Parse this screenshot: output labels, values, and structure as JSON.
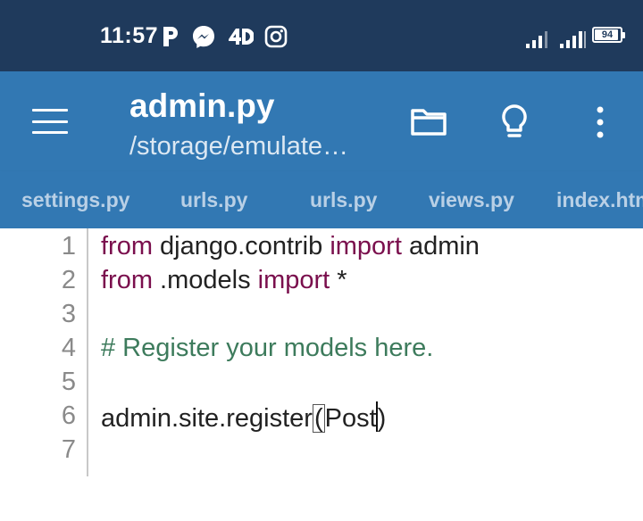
{
  "status_bar": {
    "time": "11:57",
    "notification_icons": [
      "parking-p-icon",
      "messenger-icon",
      "4d-app-icon",
      "instagram-icon"
    ],
    "battery_level": "94",
    "battery_fraction": 0.94,
    "background_color": "#1f3a5c"
  },
  "app_bar": {
    "title": "admin.py",
    "path": "/storage/emulate…",
    "menu_icon": "hamburger-menu-icon",
    "actions": [
      "folder-icon",
      "lightbulb-icon",
      "more-vertical-icon"
    ],
    "background_color": "#3278b3"
  },
  "tabs": [
    {
      "label": "settings.py"
    },
    {
      "label": "urls.py"
    },
    {
      "label": "urls.py"
    },
    {
      "label": "views.py"
    },
    {
      "label": "index.htm"
    }
  ],
  "editor": {
    "line_numbers": [
      "1",
      "2",
      "3",
      "4",
      "5",
      "6",
      "7"
    ],
    "lines": {
      "l1": {
        "kw1": "from",
        "mod": " django.contrib ",
        "kw2": "import",
        "rest": " admin"
      },
      "l2": {
        "kw1": "from",
        "mod": " .models ",
        "kw2": "import",
        "rest": " *"
      },
      "l4": {
        "comment": "# Register your models here."
      },
      "l6": {
        "call": "admin.site.register",
        "open": "(",
        "arg": "Post",
        "close": ")"
      }
    },
    "keyword_color": "#7a0f4d",
    "comment_color": "#3d7b5c"
  }
}
